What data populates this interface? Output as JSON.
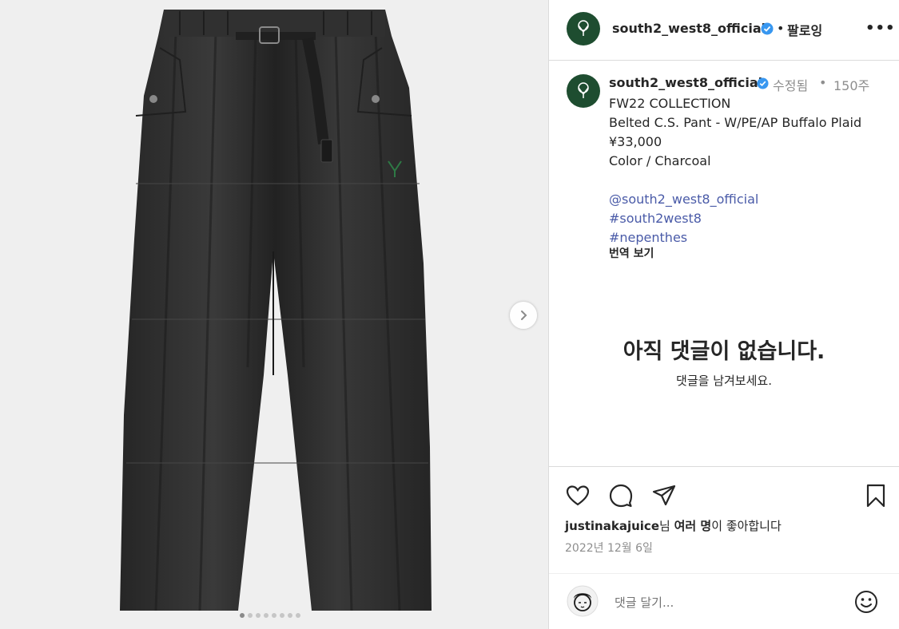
{
  "post": {
    "username": "south2_west8_official",
    "follow_separator": "•",
    "follow_label": "팔로잉",
    "more_label": "•••"
  },
  "caption": {
    "username": "south2_west8_official",
    "edited_label": "수정됨",
    "time_separator": "•",
    "time_ago": "150주",
    "lines": [
      "FW22 COLLECTION",
      "Belted C.S. Pant - W/PE/AP Buffalo Plaid",
      "¥33,000",
      "Color / Charcoal"
    ],
    "links": [
      "@south2_west8_official",
      "#south2west8",
      "#nepenthes"
    ],
    "translate_label": "번역 보기"
  },
  "comments": {
    "empty_title": "아직 댓글이 없습니다.",
    "empty_subtitle": "댓글을 남겨보세요.",
    "input_placeholder": "댓글 달기..."
  },
  "likes": {
    "liker": "justinakajuice",
    "part1": "님 ",
    "bold": "여러 명",
    "part2": "이 좋아합니다"
  },
  "date": "2022년 12월 6일",
  "icons": {
    "verified": "verified-badge-icon",
    "like": "heart-icon",
    "comment": "comment-bubble-icon",
    "share": "paper-plane-icon",
    "save": "bookmark-icon",
    "emoji": "smiley-icon",
    "next": "chevron-right-icon"
  },
  "colors": {
    "brand_green": "#1e4d30",
    "link": "#4a5ba8",
    "verified": "#3897f0",
    "muted": "#8e8e8e",
    "garment": "#2d2d2d"
  },
  "carousel": {
    "current": 1,
    "count": 8
  }
}
